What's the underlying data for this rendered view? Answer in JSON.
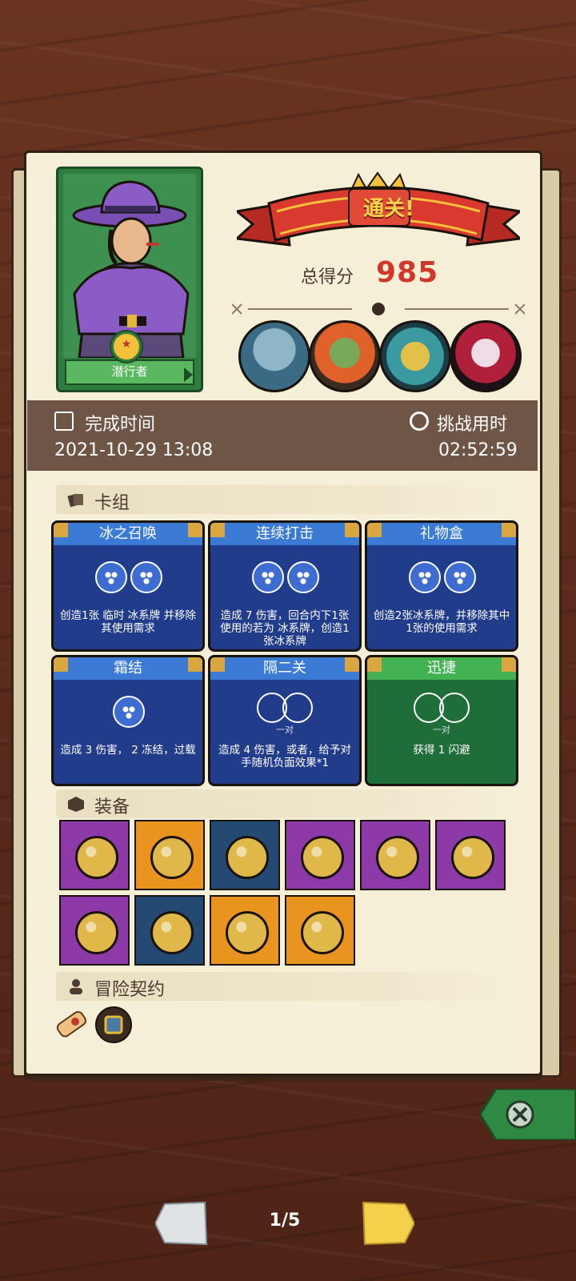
{
  "hero": {
    "name": "潜行者"
  },
  "result": {
    "banner": "通关!",
    "score_label": "总得分",
    "score": "985"
  },
  "time": {
    "complete_label": "完成时间",
    "complete_value": "2021-10-29 13:08",
    "challenge_label": "挑战用时",
    "challenge_value": "02:52:59"
  },
  "deck": {
    "header": "卡组",
    "cards": [
      {
        "title": "冰之召唤",
        "color": "blue",
        "desc": "创造1张 临时 冰系牌 并移除其使用需求",
        "sub": ""
      },
      {
        "title": "连续打击",
        "color": "blue",
        "desc": "造成 7 伤害，回合内下1张使用的若为 冰系牌，创造1张冰系牌",
        "sub": ""
      },
      {
        "title": "礼物盒",
        "color": "blue",
        "desc": "创造2张冰系牌，并移除其中1张的使用需求",
        "sub": ""
      },
      {
        "title": "霜结",
        "color": "blue",
        "desc": "造成 3 伤害， 2 冻结，过载",
        "sub": ""
      },
      {
        "title": "隔二关",
        "color": "blue",
        "desc": "造成 4 伤害，或者，给予对手随机负面效果*1",
        "sub": "一对"
      },
      {
        "title": "迅捷",
        "color": "green",
        "desc": "获得 1 闪避",
        "sub": "一对"
      }
    ]
  },
  "equipment": {
    "header": "装备",
    "items": [
      {
        "name": "amulet-icon",
        "bg": "purple"
      },
      {
        "name": "blue-slime-icon",
        "bg": "orange"
      },
      {
        "name": "pink-gem-icon",
        "bg": "navy"
      },
      {
        "name": "golden-frame-icon",
        "bg": "purple"
      },
      {
        "name": "sapphire-ring-icon",
        "bg": "purple"
      },
      {
        "name": "flame-gem-icon",
        "bg": "purple"
      },
      {
        "name": "leather-armor-icon",
        "bg": "purple"
      },
      {
        "name": "scroll-icon",
        "bg": "navy"
      },
      {
        "name": "gold-coin-icon",
        "bg": "orange"
      },
      {
        "name": "ice-shield-icon",
        "bg": "orange"
      }
    ]
  },
  "contract": {
    "header": "冒险契约",
    "items": [
      "scroll-contract-icon",
      "treasure-box-icon"
    ]
  },
  "pager": {
    "text": "1/5"
  },
  "colors": {
    "accent_red": "#d1382c",
    "card_blue": "#223c8c",
    "card_green": "#1f6e3a"
  }
}
